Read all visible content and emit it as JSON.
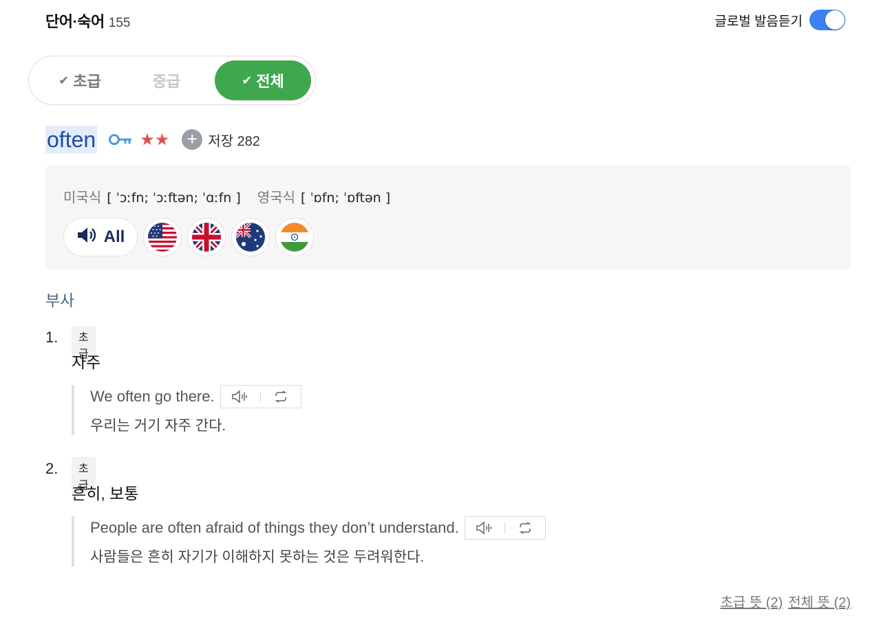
{
  "header": {
    "title": "단어·숙어",
    "count": "155"
  },
  "global_audio": {
    "label": "글로벌 발음듣기",
    "enabled": true
  },
  "level_tabs": [
    {
      "label": "초급",
      "checked": true,
      "active": false
    },
    {
      "label": "중급",
      "checked": false,
      "active": false
    },
    {
      "label": "전체",
      "checked": true,
      "active": true
    }
  ],
  "entry": {
    "headword": "often",
    "stars": "★★",
    "save_label": "저장 282",
    "pronunciation": {
      "us_label": "미국식",
      "us_ipa": "[ ˈɔːfn; ˈɔːftən; ˈɑːfn ]",
      "uk_label": "영국식",
      "uk_ipa": "[ ˈɒfn; ˈɒftən ]"
    },
    "audio_all_label": "All",
    "flags": [
      "us-flag-icon",
      "uk-flag-icon",
      "au-flag-icon",
      "in-flag-icon"
    ],
    "pos": "부사",
    "senses": [
      {
        "number": "1.",
        "level": "초급",
        "meaning": "자주",
        "example_en": "We often go there.",
        "example_ko": "우리는 거기 자주 간다."
      },
      {
        "number": "2.",
        "level": "초급",
        "meaning": "흔히, 보통",
        "example_en": "People are often afraid of things they don’t understand.",
        "example_ko": "사람들은 흔히 자기가 이해하지 못하는 것은 두려워한다."
      }
    ]
  },
  "footer": {
    "beginner_link": "초급 뜻 (2)",
    "all_link": "전체 뜻 (2)"
  },
  "colors": {
    "accent_green": "#3fa74d",
    "toggle_blue": "#3b82f6",
    "headword_blue": "#1d4ea3",
    "star_red": "#d9534f"
  }
}
